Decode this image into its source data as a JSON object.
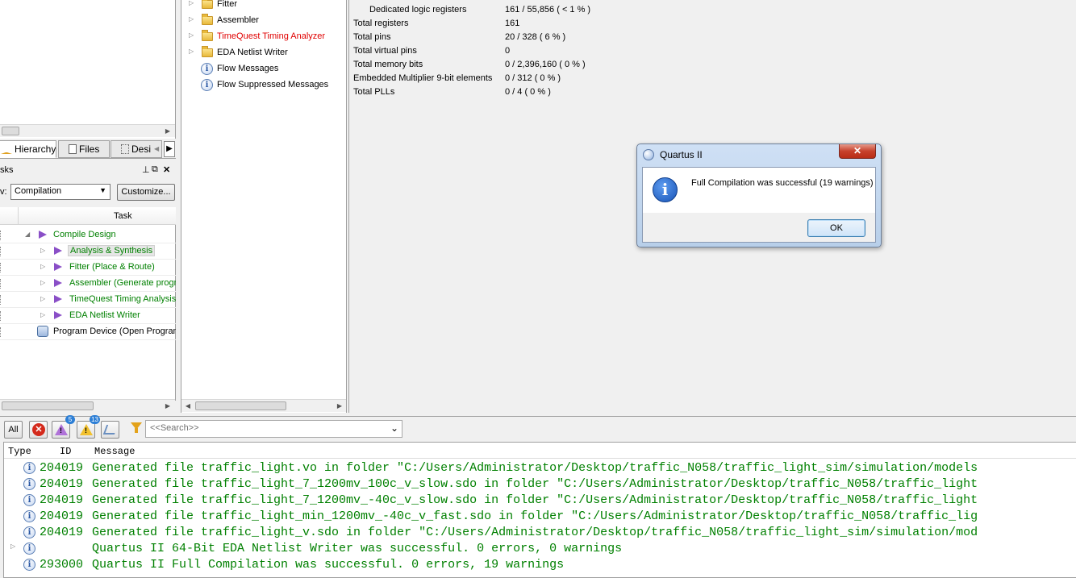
{
  "hierarchy": {
    "tabs": [
      {
        "label": "Hierarchy",
        "icon": "hierarchy-icon"
      },
      {
        "label": "Files",
        "icon": "files-icon"
      },
      {
        "label": "Desi",
        "icon": "design-units-icon"
      }
    ]
  },
  "tasks": {
    "title": "sks",
    "flow_label": "v:",
    "flow_value": "Compilation",
    "customize_label": "Customize...",
    "column_header": "Task",
    "rows": [
      {
        "label": "Compile Design"
      },
      {
        "label": "Analysis & Synthesis"
      },
      {
        "label": "Fitter (Place & Route)"
      },
      {
        "label": "Assembler (Generate progra"
      },
      {
        "label": "TimeQuest Timing Analysis"
      },
      {
        "label": "EDA Netlist Writer"
      },
      {
        "label": "Program Device (Open Program"
      }
    ]
  },
  "report_tree": {
    "items": [
      {
        "label": "Fitter",
        "icon": "folder-icon"
      },
      {
        "label": "Assembler",
        "icon": "folder-icon"
      },
      {
        "label": "TimeQuest Timing Analyzer",
        "icon": "folder-icon",
        "color": "#e00000"
      },
      {
        "label": "EDA Netlist Writer",
        "icon": "folder-icon"
      },
      {
        "label": "Flow Messages",
        "icon": "info-icon"
      },
      {
        "label": "Flow Suppressed Messages",
        "icon": "info-icon"
      }
    ]
  },
  "summary": {
    "rows": [
      {
        "key": "Dedicated logic registers",
        "value": "161 / 55,856 ( < 1 % )"
      },
      {
        "key": "Total registers",
        "value": "161"
      },
      {
        "key": "Total pins",
        "value": "20 / 328 ( 6 % )"
      },
      {
        "key": "Total virtual pins",
        "value": "0"
      },
      {
        "key": "Total memory bits",
        "value": "0 / 2,396,160 ( 0 % )"
      },
      {
        "key": "Embedded Multiplier 9-bit elements",
        "value": "0 / 312 ( 0 % )"
      },
      {
        "key": "Total PLLs",
        "value": "0 / 4 ( 0 % )"
      }
    ]
  },
  "dialog": {
    "title": "Quartus II",
    "close_label": "✕",
    "message": "Full Compilation was successful (19 warnings)",
    "ok_label": "OK"
  },
  "messages": {
    "all_label": "All",
    "critical_count": "5",
    "warning_count": "13",
    "search_placeholder": "<<Search>>",
    "columns": [
      "Type",
      "ID",
      "Message"
    ],
    "rows": [
      {
        "id": "204019",
        "text": "Generated file traffic_light.vo in folder \"C:/Users/Administrator/Desktop/traffic_N058/traffic_light_sim/simulation/models"
      },
      {
        "id": "204019",
        "text": "Generated file traffic_light_7_1200mv_100c_v_slow.sdo in folder \"C:/Users/Administrator/Desktop/traffic_N058/traffic_light"
      },
      {
        "id": "204019",
        "text": "Generated file traffic_light_7_1200mv_-40c_v_slow.sdo in folder \"C:/Users/Administrator/Desktop/traffic_N058/traffic_light"
      },
      {
        "id": "204019",
        "text": "Generated file traffic_light_min_1200mv_-40c_v_fast.sdo in folder \"C:/Users/Administrator/Desktop/traffic_N058/traffic_lig"
      },
      {
        "id": "204019",
        "text": "Generated file traffic_light_v.sdo in folder \"C:/Users/Administrator/Desktop/traffic_N058/traffic_light_sim/simulation/mod"
      },
      {
        "id": "",
        "text": "Quartus II 64-Bit EDA Netlist Writer was successful. 0 errors, 0 warnings",
        "expandable": true
      },
      {
        "id": "293000",
        "text": "Quartus II Full Compilation was successful. 0 errors, 19 warnings"
      }
    ]
  },
  "colors": {
    "task_text": "#008000",
    "message_text": "#008000",
    "error_text": "#e00000",
    "task_arrow": "#8a4fc7"
  }
}
